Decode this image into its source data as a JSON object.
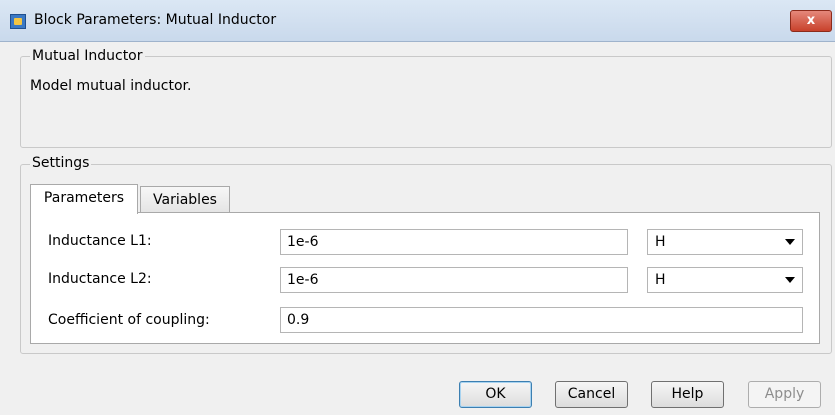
{
  "window": {
    "title": "Block Parameters: Mutual Inductor",
    "close_label": "x"
  },
  "block": {
    "group_title": "Mutual Inductor",
    "description": "Model mutual inductor."
  },
  "settings": {
    "group_title": "Settings",
    "tabs": [
      {
        "label": "Parameters",
        "active": true
      },
      {
        "label": "Variables",
        "active": false
      }
    ],
    "rows": [
      {
        "label": "Inductance L1:",
        "value": "1e-6",
        "unit": "H"
      },
      {
        "label": "Inductance L2:",
        "value": "1e-6",
        "unit": "H"
      },
      {
        "label": "Coefficient of coupling:",
        "value": "0.9"
      }
    ]
  },
  "buttons": {
    "ok": "OK",
    "cancel": "Cancel",
    "help": "Help",
    "apply": "Apply"
  }
}
